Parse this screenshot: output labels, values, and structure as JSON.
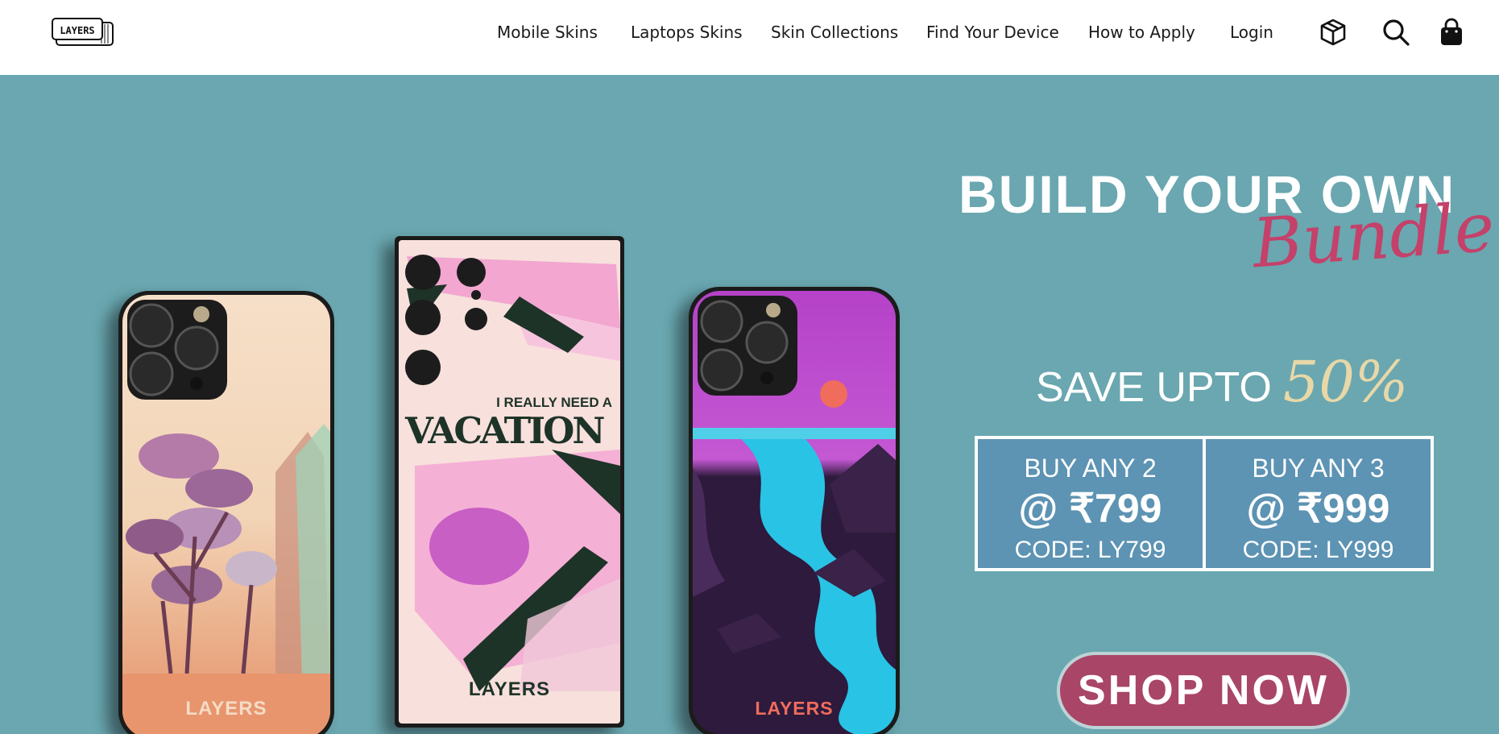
{
  "header": {
    "logo_text": "LAYERS",
    "nav": [
      {
        "label": "Mobile Skins"
      },
      {
        "label": "Laptops Skins"
      },
      {
        "label": "Skin Collections"
      },
      {
        "label": "Find Your Device"
      },
      {
        "label": "How to Apply"
      },
      {
        "label": "Login"
      }
    ],
    "icons": [
      "box-icon",
      "search-icon",
      "bag-icon"
    ]
  },
  "hero": {
    "headline": "BUILD YOUR OWN",
    "script": "Bundle",
    "save_text": "SAVE UPTO",
    "save_pct": "50%",
    "offers": [
      {
        "line1": "BUY ANY 2",
        "line2": "@ ₹799",
        "line3": "CODE: LY799"
      },
      {
        "line1": "BUY ANY 3",
        "line2": "@ ₹999",
        "line3": "CODE: LY999"
      }
    ],
    "cta": "SHOP NOW",
    "phones": [
      {
        "brand": "LAYERS"
      },
      {
        "brand": "LAYERS",
        "tagline": "I REALLY NEED A",
        "title": "VACATION"
      },
      {
        "brand": "LAYERS"
      }
    ]
  },
  "colors": {
    "hero_bg": "#6aa7b0",
    "offer_bg": "#5d93b3",
    "cta_bg": "#a94567",
    "script": "#c4416a"
  }
}
